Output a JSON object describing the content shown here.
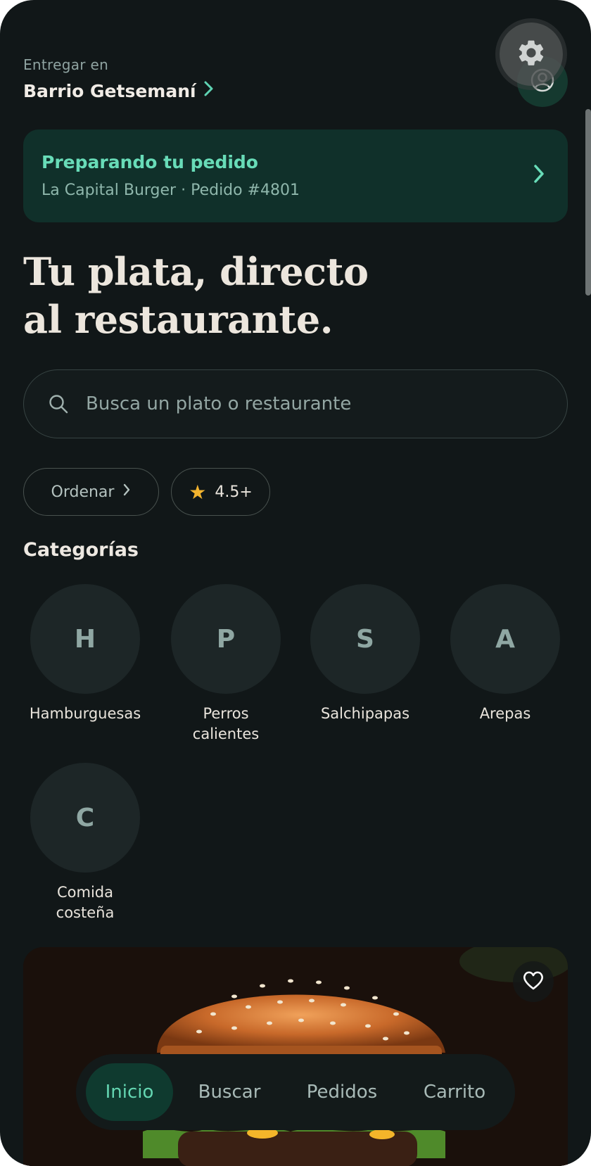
{
  "header": {
    "deliver_label": "Entregar en",
    "deliver_place": "Barrio Getsemaní"
  },
  "icons": {
    "settings": "gear-icon",
    "profile": "user-circle-icon",
    "search": "search-icon",
    "favorite": "heart-icon",
    "star": "star-icon"
  },
  "order": {
    "title": "Preparando tu pedido",
    "subtitle": "La Capital Burger · Pedido #4801"
  },
  "headline": {
    "line1": "Tu plata, directo",
    "line2": "al restaurante."
  },
  "search": {
    "placeholder": "Busca un plato o restaurante"
  },
  "filters": {
    "sort_label": "Ordenar",
    "rating_label": "4.5+"
  },
  "categories": {
    "title": "Categorías",
    "items": [
      {
        "initial": "H",
        "label": "Hamburguesas"
      },
      {
        "initial": "P",
        "label": "Perros calientes"
      },
      {
        "initial": "S",
        "label": "Salchipapas"
      },
      {
        "initial": "A",
        "label": "Arepas"
      },
      {
        "initial": "C",
        "label": "Comida costeña"
      }
    ]
  },
  "nav": {
    "items": [
      "Inicio",
      "Buscar",
      "Pedidos",
      "Carrito"
    ],
    "active": "Inicio"
  },
  "colors": {
    "background": "#111718",
    "accent": "#64d6b2",
    "star": "#f3b42f"
  }
}
